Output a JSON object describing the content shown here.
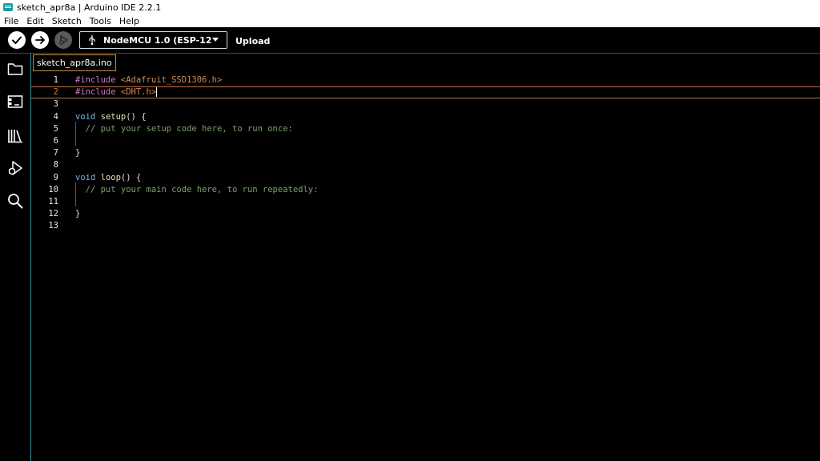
{
  "window": {
    "title": "sketch_apr8a | Arduino IDE 2.2.1"
  },
  "menu": [
    "File",
    "Edit",
    "Sketch",
    "Tools",
    "Help"
  ],
  "toolbar": {
    "board_label": "NodeMCU 1.0 (ESP-12E ...",
    "hover_label": "Upload"
  },
  "sidebar": [
    "folder-icon",
    "board-manager-icon",
    "library-icon",
    "debug-icon",
    "search-icon"
  ],
  "tab": {
    "name": "sketch_apr8a.ino"
  },
  "editor": {
    "current_line": 2,
    "lines": [
      {
        "num": "1",
        "tokens": [
          {
            "t": "#include",
            "c": "directive"
          },
          {
            "t": " <Adafruit_SSD1306.h>",
            "c": "header"
          }
        ]
      },
      {
        "num": "2",
        "tokens": [
          {
            "t": "#include",
            "c": "directive"
          },
          {
            "t": " <DHT.h>",
            "c": "header"
          }
        ]
      },
      {
        "num": "3",
        "tokens": []
      },
      {
        "num": "4",
        "tokens": [
          {
            "t": "void",
            "c": "type"
          },
          {
            "t": " ",
            "c": "punc"
          },
          {
            "t": "setup",
            "c": "func"
          },
          {
            "t": "() {",
            "c": "punc"
          }
        ]
      },
      {
        "num": "5",
        "tokens": [
          {
            "t": "  // put your setup code here, to run once:",
            "c": "comment"
          }
        ]
      },
      {
        "num": "6",
        "tokens": []
      },
      {
        "num": "7",
        "tokens": [
          {
            "t": "}",
            "c": "punc"
          }
        ]
      },
      {
        "num": "8",
        "tokens": []
      },
      {
        "num": "9",
        "tokens": [
          {
            "t": "void",
            "c": "type"
          },
          {
            "t": " ",
            "c": "punc"
          },
          {
            "t": "loop",
            "c": "func"
          },
          {
            "t": "() {",
            "c": "punc"
          }
        ]
      },
      {
        "num": "10",
        "tokens": [
          {
            "t": "  // put your main code here, to run repeatedly:",
            "c": "comment"
          }
        ]
      },
      {
        "num": "11",
        "tokens": []
      },
      {
        "num": "12",
        "tokens": [
          {
            "t": "}",
            "c": "punc"
          }
        ]
      },
      {
        "num": "13",
        "tokens": []
      }
    ]
  }
}
